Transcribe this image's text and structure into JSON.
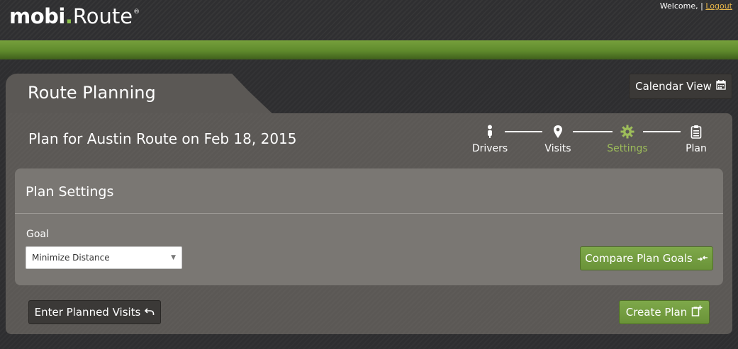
{
  "header": {
    "logo": {
      "bold": "mobi",
      "dot": ".",
      "light": "Route",
      "reg": "®"
    },
    "welcome_text": "Welcome, |",
    "logout_label": "Logout"
  },
  "page": {
    "tab_title": "Route Planning",
    "plan_title": "Plan for Austin Route on Feb 18, 2015",
    "calendar_button": "Calendar View"
  },
  "steps": [
    {
      "label": "Drivers",
      "icon": "driver-icon",
      "active": false
    },
    {
      "label": "Visits",
      "icon": "map-pin-icon",
      "active": false
    },
    {
      "label": "Settings",
      "icon": "gear-icon",
      "active": true
    },
    {
      "label": "Plan",
      "icon": "clipboard-icon",
      "active": false
    }
  ],
  "plan_settings": {
    "title": "Plan Settings",
    "goal_label": "Goal",
    "goal_value": "Minimize Distance",
    "compare_button": "Compare Plan Goals"
  },
  "footer": {
    "enter_visits_button": "Enter Planned Visits",
    "create_plan_button": "Create Plan"
  },
  "colors": {
    "accent_green": "#6a9338",
    "active_step": "#9dbd5a",
    "logout_link": "#e8b74a",
    "panel": "#5b5855"
  }
}
